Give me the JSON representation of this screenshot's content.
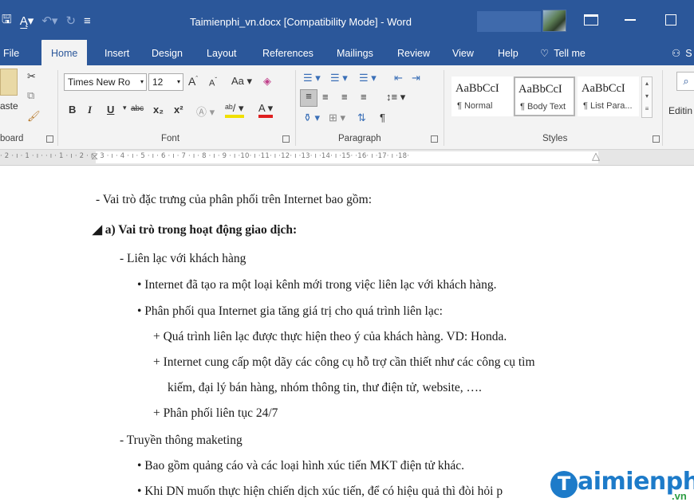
{
  "window": {
    "title": "Taimienphi_vn.docx [Compatibility Mode]  -  Word"
  },
  "tabs": {
    "file": "File",
    "home": "Home",
    "insert": "Insert",
    "design": "Design",
    "layout": "Layout",
    "references": "References",
    "mailings": "Mailings",
    "review": "Review",
    "view": "View",
    "help": "Help",
    "tell_me": "Tell me",
    "share": "S"
  },
  "ribbon": {
    "clipboard": {
      "paste_label": "aste",
      "group_label": "board"
    },
    "font": {
      "font_name": "Times New Ro",
      "font_size": "12",
      "group_label": "Font",
      "bold": "B",
      "italic": "I",
      "underline": "U",
      "strikethrough": "abc",
      "subscript": "x₂",
      "superscript": "x²",
      "grow": "A",
      "shrink": "A",
      "change_case": "Aa",
      "font_color": "A"
    },
    "paragraph": {
      "group_label": "Paragraph",
      "show_marks": "¶"
    },
    "styles": {
      "group_label": "Styles",
      "items": [
        {
          "sample": "AaBbCcI",
          "name": "¶ Normal"
        },
        {
          "sample": "AaBbCcI",
          "name": "¶ Body Text"
        },
        {
          "sample": "AaBbCcI",
          "name": "¶ List Para..."
        }
      ]
    },
    "editing": {
      "label": "Editin"
    }
  },
  "ruler": {
    "text": "· 2 · ı · 1 · ı · ·   ı · 1 · ı · 2 · ı · 3 · ı · 4 · ı · 5 · ı · 6 · ı · 7 · ı · 8 · ı · 9 · ı ·10· ı ·11· ı ·12· ı ·13· ı ·14· ı ·15·   ·16· ı ·17· ı ·18·"
  },
  "document": {
    "lines": [
      {
        "text": "-   Vai trò đặc trưng của phân phối trên Internet bao  gồm:"
      },
      {
        "text": "◢ a) Vai trò trong hoạt động giao dịch:"
      },
      {
        "text": "-   Liên lạc với khách hàng"
      },
      {
        "text": "•  Internet đã tạo ra một loại kênh mới trong việc liên lạc với khách hàng."
      },
      {
        "text": "•  Phân phối qua Internet gia tăng giá trị cho quá trình liên  lạc:"
      },
      {
        "text": "+  Quá trình liên lạc được thực hiện theo ý của khách hàng. VD:  Honda."
      },
      {
        "text": "+  Internet cung cấp một dãy các công cụ hỗ trợ cần thiết như các công cụ tìm"
      },
      {
        "text": "kiếm, đại lý bán hàng, nhóm thông tin, thư điện tử, website,  …."
      },
      {
        "text": "+  Phân phối liên tục 24/7"
      },
      {
        "text": "-   Truyền thông maketing"
      },
      {
        "text": "•  Bao gồm quảng cáo và các loại hình xúc tiến MKT điện tử  khác."
      },
      {
        "text": "•  Khi DN muốn thực hiện chiến dịch xúc tiến, để có hiệu quả thì đòi hỏi p"
      }
    ]
  },
  "watermark": {
    "letter": "T",
    "word": "aimienphi",
    "suffix": ".vn"
  },
  "colors": {
    "word_blue": "#2b579a",
    "ribbon_bg": "#f3f3f3",
    "logo_blue": "#1d7bc9",
    "logo_green": "#2e9e44"
  }
}
